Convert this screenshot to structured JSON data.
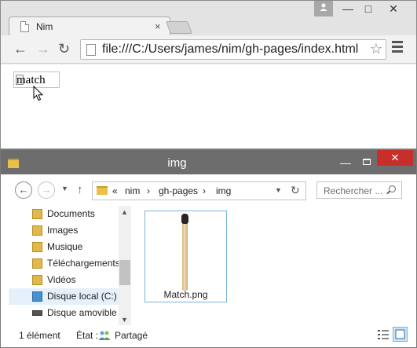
{
  "chrome": {
    "tab_title": "Nim",
    "tab_close": "×",
    "user_icon": "person-icon",
    "minimize": "—",
    "maximize": "□",
    "close": "✕",
    "back": "←",
    "forward": "→",
    "reload": "↻",
    "url": "file:///C:/Users/james/nim/gh-pages/index.html",
    "star": "☆",
    "broken_image_alt": "match"
  },
  "explorer": {
    "title": "img",
    "minimize": "—",
    "close": "✕",
    "back": "←",
    "forward": "→",
    "up": "↑",
    "breadcrumbs": [
      "«",
      "nim",
      "›",
      "gh-pages",
      "›",
      "img"
    ],
    "search_placeholder": "Rechercher ...",
    "nav_items": [
      {
        "label": "Documents",
        "icon": "documents-folder-icon"
      },
      {
        "label": "Images",
        "icon": "pictures-folder-icon"
      },
      {
        "label": "Musique",
        "icon": "music-folder-icon"
      },
      {
        "label": "Téléchargements",
        "icon": "downloads-folder-icon"
      },
      {
        "label": "Vidéos",
        "icon": "videos-folder-icon"
      },
      {
        "label": "Disque local (C:)",
        "icon": "drive-icon"
      },
      {
        "label": "Disque amovible",
        "icon": "removable-drive-icon"
      }
    ],
    "files": [
      {
        "name": "Match.png",
        "icon": "match-thumbnail"
      }
    ],
    "status_count": "1 élément",
    "status_state_label": "État :",
    "status_state_value": "Partagé"
  },
  "colors": {
    "explorer_titlebar": "#6d6d6d",
    "close_red": "#c7302a",
    "selection": "#e5f0fb"
  }
}
